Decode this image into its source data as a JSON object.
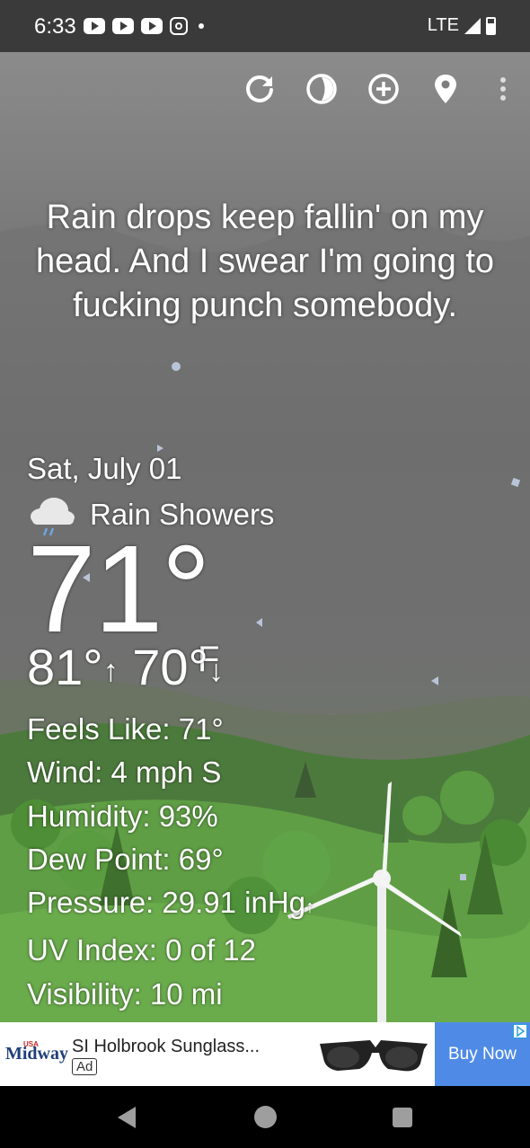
{
  "status_bar": {
    "time": "6:33",
    "network": "LTE"
  },
  "toolbar": {
    "icons": [
      "refresh-icon",
      "theme-icon",
      "add-location-icon",
      "location-pin-icon",
      "more-vert-icon"
    ]
  },
  "quote": "Rain drops keep fallin' on my head. And I swear I'm going to fucking punch somebody.",
  "weather": {
    "date": "Sat, July 01",
    "condition": "Rain Showers",
    "condition_icon": "rain-cloud-icon",
    "temperature": "71°",
    "unit": "F",
    "high": "81°",
    "low": "70°",
    "details": {
      "feels_like": "Feels Like:  71°",
      "wind": "Wind:  4 mph S",
      "humidity": "Humidity:  93%",
      "dew_point": "Dew Point:  69°",
      "pressure": "Pressure:  29.91 inHg",
      "pressure_trend": "↑",
      "uv_index": "UV Index:  0 of 12",
      "visibility": "Visibility:  10 mi"
    }
  },
  "ad": {
    "brand_logo": "Midway",
    "brand_sup": "USA",
    "title": "SI Holbrook Sunglass...",
    "badge": "Ad",
    "cta": "Buy Now",
    "cta_color": "#4f8be6"
  },
  "nav": {
    "icons": [
      "back-icon",
      "home-icon",
      "recents-icon"
    ]
  }
}
